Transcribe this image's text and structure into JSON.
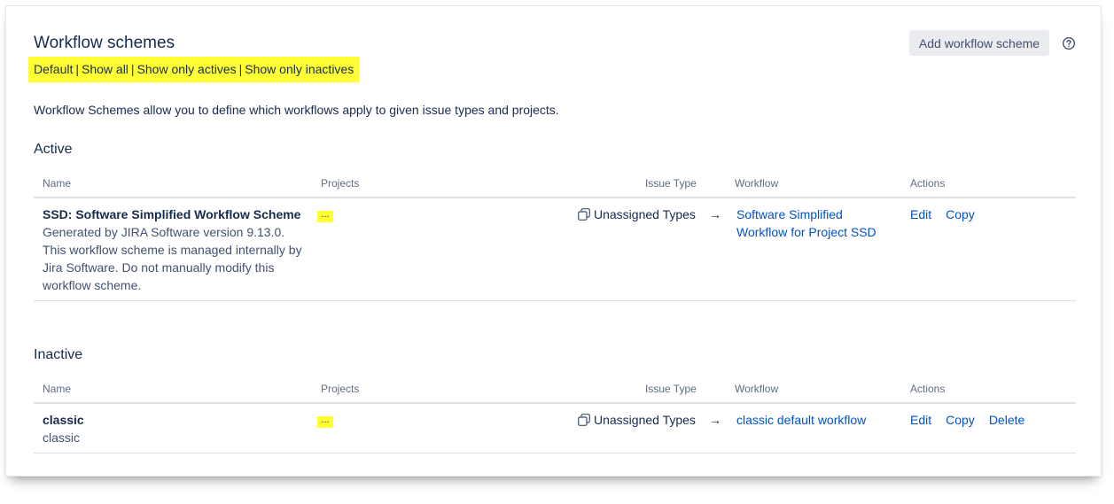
{
  "header": {
    "title": "Workflow schemes",
    "add_button_label": "Add workflow scheme",
    "help_icon": "question-circle-icon"
  },
  "filters": {
    "default": "Default",
    "show_all": "Show all",
    "show_actives": "Show only actives",
    "show_inactives": "Show only inactives",
    "separator": "|",
    "highlight_color": "#ffff33"
  },
  "description": "Workflow Schemes allow you to define which workflows apply to given issue types and projects.",
  "columns": {
    "name": "Name",
    "projects": "Projects",
    "issue_type": "Issue Type",
    "workflow": "Workflow",
    "actions": "Actions"
  },
  "active": {
    "title": "Active",
    "rows": [
      {
        "name": "SSD: Software Simplified Workflow Scheme",
        "description": "Generated by JIRA Software version 9.13.0. This workflow scheme is managed internally by Jira Software. Do not manually modify this workflow scheme.",
        "projects": "...",
        "issue_type": "Unassigned Types",
        "arrow": "→",
        "workflow": "Software Simplified Workflow for Project SSD",
        "actions": [
          "Edit",
          "Copy"
        ]
      }
    ]
  },
  "inactive": {
    "title": "Inactive",
    "rows": [
      {
        "name": "classic",
        "description": "classic",
        "projects": "...",
        "issue_type": "Unassigned Types",
        "arrow": "→",
        "workflow": "classic default workflow",
        "actions": [
          "Edit",
          "Copy",
          "Delete"
        ]
      }
    ]
  },
  "colors": {
    "link": "#0052cc",
    "text": "#172b4d",
    "muted": "#5e6c84",
    "button_bg": "#ebecf0"
  }
}
